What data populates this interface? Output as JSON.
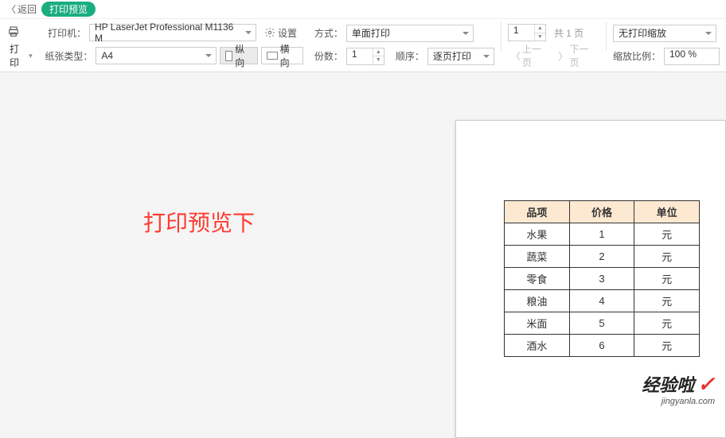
{
  "titlebar": {
    "back": "返回",
    "title": "打印预览"
  },
  "toolbar": {
    "print_btn": "打印",
    "printer_label": "打印机：",
    "printer_value": "HP LaserJet Professional M1136 M",
    "settings": "设置",
    "paper_label": "纸张类型：",
    "paper_value": "A4",
    "orient_portrait": "纵向",
    "orient_landscape": "横向",
    "mode_label": "方式：",
    "mode_value": "单面打印",
    "copies_label": "份数：",
    "copies_value": "1",
    "order_label": "顺序：",
    "order_value": "逐页打印",
    "page_input": "1",
    "total_pages": "共 1 页",
    "prev_page": "上一页",
    "next_page": "下一页",
    "zoom_label_top": "无打印缩放",
    "zoom_ratio_label": "缩放比例：",
    "zoom_value": "100 %"
  },
  "preview": {
    "overlay_text": "打印预览下"
  },
  "chart_data": {
    "type": "table",
    "columns": [
      "品项",
      "价格",
      "单位"
    ],
    "rows": [
      [
        "水果",
        "1",
        "元"
      ],
      [
        "蔬菜",
        "2",
        "元"
      ],
      [
        "零食",
        "3",
        "元"
      ],
      [
        "粮油",
        "4",
        "元"
      ],
      [
        "米面",
        "5",
        "元"
      ],
      [
        "酒水",
        "6",
        "元"
      ]
    ]
  },
  "watermark": {
    "main": "经验啦",
    "sub": "jingyanla.com"
  }
}
